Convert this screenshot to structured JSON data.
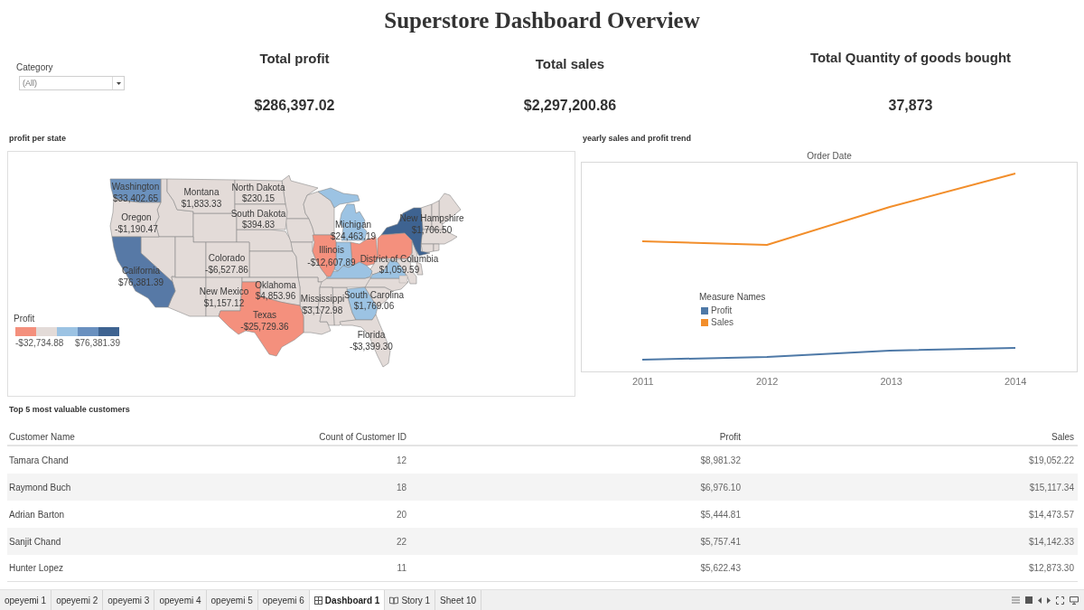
{
  "title": "Superstore Dashboard Overview",
  "filter": {
    "label": "Category",
    "value": "(All)"
  },
  "kpis": [
    {
      "title": "Total profit",
      "value": "$286,397.02"
    },
    {
      "title": "Total sales",
      "value": "$2,297,200.86"
    },
    {
      "title": "Total Quantity of goods bought",
      "value": "37,873"
    }
  ],
  "profit_map": {
    "title": "profit per state",
    "states": [
      {
        "label": "Washington",
        "value": "$33,402.65",
        "color": "#6b91bd"
      },
      {
        "label": "Montana",
        "value": "$1,833.33",
        "color": "#e3dbd8"
      },
      {
        "label": "North Dakota",
        "value": "$230.15",
        "color": "#e3dbd8"
      },
      {
        "label": "Oregon",
        "value": "-$1,190.47",
        "color": "#e3dbd8"
      },
      {
        "label": "South Dakota",
        "value": "$394.83",
        "color": "#e3dbd8"
      },
      {
        "label": "Michigan",
        "value": "$24,463.19",
        "color": "#9cc3e3"
      },
      {
        "label": "New Hampshire",
        "value": "$1,706.50",
        "color": "#e3dbd8"
      },
      {
        "label": "Colorado",
        "value": "-$6,527.86",
        "color": "#e3dbd8"
      },
      {
        "label": "Illinois",
        "value": "-$12,607.89",
        "color": "#f4907d"
      },
      {
        "label": "District of Columbia",
        "value": "$1,059.59",
        "color": "#e3dbd8"
      },
      {
        "label": "California",
        "value": "$76,381.39",
        "color": "#5779a6"
      },
      {
        "label": "New Mexico",
        "value": "$1,157.12",
        "color": "#e3dbd8"
      },
      {
        "label": "Oklahoma",
        "value": "$4,853.96",
        "color": "#e3dbd8"
      },
      {
        "label": "Mississippi",
        "value": "$3,172.98",
        "color": "#e3dbd8"
      },
      {
        "label": "South Carolina",
        "value": "$1,769.06",
        "color": "#e3dbd8"
      },
      {
        "label": "Texas",
        "value": "-$25,729.36",
        "color": "#f4907d"
      },
      {
        "label": "Florida",
        "value": "-$3,399.30",
        "color": "#e3dbd8"
      }
    ],
    "unlabeled_states": [
      {
        "color": "#3e6391"
      },
      {
        "color": "#f4907d"
      },
      {
        "color": "#f4907d"
      },
      {
        "color": "#9cc3e3"
      },
      {
        "color": "#9cc3e3"
      },
      {
        "color": "#9cc3e3"
      },
      {
        "color": "#9cc3e3"
      }
    ],
    "legend": {
      "title": "Profit",
      "steps": [
        {
          "color": "#f4907d"
        },
        {
          "color": "#e3dbd8"
        },
        {
          "color": "#9cc3e3"
        },
        {
          "color": "#6990bf"
        },
        {
          "color": "#3e6391"
        }
      ],
      "min_label": "-$32,734.88",
      "max_label": "$76,381.39"
    }
  },
  "trend_chart": {
    "title": "yearly sales and profit trend",
    "axis_title": "Order Date",
    "x_labels": [
      "2011",
      "2012",
      "2013",
      "2014"
    ],
    "legend": {
      "title": "Measure Names",
      "items": [
        {
          "label": "Profit",
          "color": "#4e79a7"
        },
        {
          "label": "Sales",
          "color": "#f28e2b"
        }
      ]
    }
  },
  "customers_table": {
    "title": "Top 5 most valuable customers",
    "columns": [
      "Customer Name",
      "Count of Customer ID",
      "Profit",
      "Sales"
    ],
    "rows": [
      [
        "Tamara Chand",
        "12",
        "$8,981.32",
        "$19,052.22"
      ],
      [
        "Raymond Buch",
        "18",
        "$6,976.10",
        "$15,117.34"
      ],
      [
        "Adrian Barton",
        "20",
        "$5,444.81",
        "$14,473.57"
      ],
      [
        "Sanjit Chand",
        "22",
        "$5,757.41",
        "$14,142.33"
      ],
      [
        "Hunter Lopez",
        "11",
        "$5,622.43",
        "$12,873.30"
      ]
    ]
  },
  "tabs": [
    {
      "label": "opeyemi 1",
      "kind": "sheet",
      "selected": false
    },
    {
      "label": "opeyemi 2",
      "kind": "sheet",
      "selected": false
    },
    {
      "label": "opeyemi 3",
      "kind": "sheet",
      "selected": false
    },
    {
      "label": "opeyemi 4",
      "kind": "sheet",
      "selected": false
    },
    {
      "label": "opeyemi 5",
      "kind": "sheet",
      "selected": false
    },
    {
      "label": "opeyemi 6",
      "kind": "sheet",
      "selected": false
    },
    {
      "label": "Dashboard 1",
      "kind": "dashboard",
      "selected": true
    },
    {
      "label": "Story 1",
      "kind": "story",
      "selected": false
    },
    {
      "label": "Sheet 10",
      "kind": "sheet",
      "selected": false
    }
  ]
}
